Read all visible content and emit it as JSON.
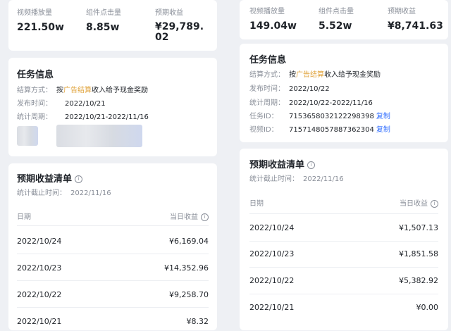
{
  "left": {
    "stats": [
      {
        "label": "视频播放量",
        "value": "221.50w"
      },
      {
        "label": "组件点击量",
        "value": "8.85w"
      },
      {
        "label": "预期收益",
        "value_line1": "¥29,789.",
        "value_line2": "02"
      }
    ],
    "task_info": {
      "title": "任务信息",
      "rows": [
        {
          "label": "结算方式：",
          "prefix": "按",
          "highlight": "广告结算",
          "suffix": "收入给予现金奖励"
        },
        {
          "label": "发布时间：",
          "value": "2022/10/21"
        },
        {
          "label": "统计周期：",
          "value": "2022/10/21-2022/11/16"
        }
      ]
    },
    "earnings": {
      "title": "预期收益清单",
      "deadline_label": "统计截止时间：",
      "deadline": "2022/11/16",
      "col_date": "日期",
      "col_income": "当日收益",
      "rows": [
        {
          "date": "2022/10/24",
          "amount": "¥6,169.04"
        },
        {
          "date": "2022/10/23",
          "amount": "¥14,352.96"
        },
        {
          "date": "2022/10/22",
          "amount": "¥9,258.70"
        },
        {
          "date": "2022/10/21",
          "amount": "¥8.32"
        }
      ]
    }
  },
  "right": {
    "stats": [
      {
        "label": "视频播放量",
        "value": "149.04w"
      },
      {
        "label": "组件点击量",
        "value": "5.52w"
      },
      {
        "label": "预期收益",
        "value": "¥8,741.63"
      }
    ],
    "task_info": {
      "title": "任务信息",
      "rows": [
        {
          "label": "结算方式：",
          "prefix": "按",
          "highlight": "广告结算",
          "suffix": "收入给予现金奖励"
        },
        {
          "label": "发布时间：",
          "value": "2022/10/22"
        },
        {
          "label": "统计周期：",
          "value": "2022/10/22-2022/11/16"
        },
        {
          "label": "任务ID：",
          "value": "7153658032122298398",
          "action": "复制"
        },
        {
          "label": "视频ID：",
          "value": "7157148057887362304",
          "action": "复制"
        }
      ]
    },
    "earnings": {
      "title": "预期收益清单",
      "deadline_label": "统计截止时间：",
      "deadline": "2022/11/16",
      "col_date": "日期",
      "col_income": "当日收益",
      "rows": [
        {
          "date": "2022/10/24",
          "amount": "¥1,507.13"
        },
        {
          "date": "2022/10/23",
          "amount": "¥1,851.58"
        },
        {
          "date": "2022/10/22",
          "amount": "¥5,382.92"
        },
        {
          "date": "2022/10/21",
          "amount": "¥0.00"
        }
      ]
    }
  },
  "colors": {
    "highlight": "#e0a33b",
    "link": "#3370ff",
    "background": "#eef0f4"
  }
}
